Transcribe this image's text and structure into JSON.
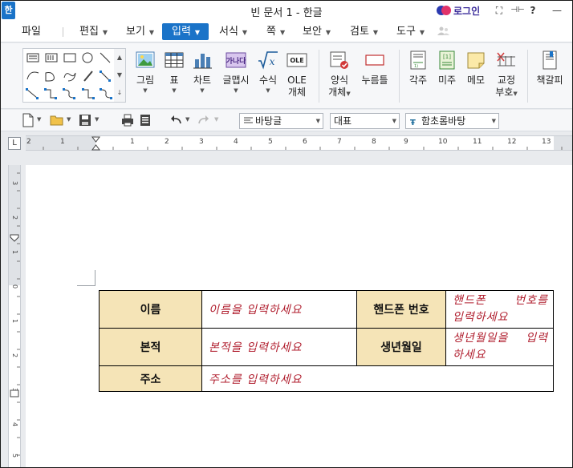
{
  "app": {
    "icon_label": "한",
    "title": "빈 문서 1 - 한글",
    "login_label": "로그인",
    "window_controls": [
      "⛶",
      "⊣⊢",
      "?",
      "—"
    ]
  },
  "menu": {
    "file": "파일",
    "items": [
      "편집",
      "보기",
      "입력",
      "서식",
      "쪽",
      "보안",
      "검토",
      "도구"
    ],
    "active": "입력"
  },
  "ribbon": {
    "shape_gallery_icons": [
      "text-box-icon",
      "table-box-icon",
      "rectangle-icon",
      "ellipse-icon",
      "line-icon",
      "arc-icon",
      "freeform-icon",
      "curve-icon",
      "pen-icon",
      "connector-icon",
      "elbow-connector-icon",
      "curved-connector-icon",
      "double-connector-icon",
      "double-elbow-icon",
      "double-curve-icon"
    ],
    "buttons": [
      {
        "label": "그림",
        "icon": "picture-icon",
        "has_menu": true
      },
      {
        "label": "표",
        "icon": "table-icon",
        "has_menu": true
      },
      {
        "label": "차트",
        "icon": "chart-icon",
        "has_menu": true
      },
      {
        "label": "글맵시",
        "icon": "wordart-icon",
        "has_menu": true
      },
      {
        "label": "수식",
        "icon": "formula-icon",
        "has_menu": true
      },
      {
        "label": "OLE",
        "label2": "개체",
        "icon": "ole-icon",
        "has_menu": false
      },
      {
        "label": "양식",
        "label2": "개체",
        "icon": "form-object-icon",
        "has_menu": true
      },
      {
        "label": "누름틀",
        "icon": "field-icon",
        "has_menu": false
      },
      {
        "label": "각주",
        "icon": "footnote-icon",
        "has_menu": false
      },
      {
        "label": "미주",
        "icon": "endnote-icon",
        "has_menu": false
      },
      {
        "label": "메모",
        "icon": "memo-icon",
        "has_menu": false
      },
      {
        "label": "교정",
        "label2": "부호",
        "icon": "proofreading-icon",
        "has_menu": true
      },
      {
        "label": "책갈피",
        "icon": "bookmark-icon",
        "has_menu": false
      }
    ]
  },
  "toolbar": {
    "style": "바탕글",
    "language": "대표",
    "font": "함초롬바탕"
  },
  "ruler": {
    "corner": "L",
    "h_numbers": [
      "2",
      "1",
      "1",
      "2",
      "3",
      "4",
      "5",
      "6",
      "7",
      "8",
      "9",
      "10",
      "11",
      "12",
      "13"
    ],
    "v_numbers": [
      "3",
      "2",
      "1",
      "0",
      "1",
      "2",
      "3",
      "4",
      "5"
    ]
  },
  "document": {
    "rows": [
      [
        {
          "type": "label",
          "text": "이름"
        },
        {
          "type": "value",
          "text": "이름을 입력하세요"
        },
        {
          "type": "label",
          "text": "핸드폰 번호"
        },
        {
          "type": "value",
          "text": "핸드폰 번호를",
          "text2": "입력하세요"
        }
      ],
      [
        {
          "type": "label",
          "text": "본적"
        },
        {
          "type": "value",
          "text": "본적을 입력하세요"
        },
        {
          "type": "label",
          "text": "생년월일"
        },
        {
          "type": "value",
          "text": "생년월일을 입력",
          "text2": "하세요"
        }
      ],
      [
        {
          "type": "label",
          "text": "주소"
        },
        {
          "type": "value",
          "text": "주소를 입력하세요"
        }
      ]
    ],
    "colors": {
      "label_bg": "#f5e4b7",
      "placeholder_text": "#b01e2e",
      "accent": "#1a73c8"
    }
  }
}
